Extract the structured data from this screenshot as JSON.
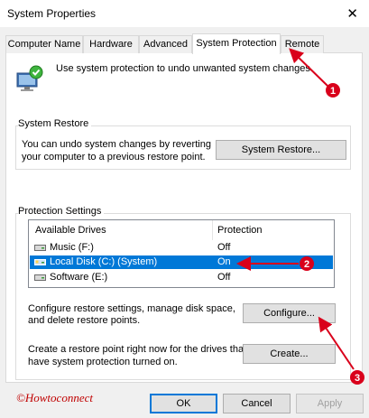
{
  "window": {
    "title": "System Properties",
    "close_glyph": "✕"
  },
  "tabs": [
    {
      "label": "Computer Name"
    },
    {
      "label": "Hardware"
    },
    {
      "label": "Advanced"
    },
    {
      "label": "System Protection",
      "active": true
    },
    {
      "label": "Remote"
    }
  ],
  "intro": {
    "text": "Use system protection to undo unwanted system changes."
  },
  "system_restore": {
    "group_label": "System Restore",
    "description_line1": "You can undo system changes by reverting",
    "description_line2": "your computer to a previous restore point.",
    "button_label": "System Restore..."
  },
  "protection_settings": {
    "group_label": "Protection Settings",
    "columns": {
      "drives": "Available Drives",
      "protection": "Protection"
    },
    "drives": [
      {
        "name": "Music (F:)",
        "protection": "Off",
        "icon": "drive-icon"
      },
      {
        "name": "Local Disk (C:) (System)",
        "protection": "On",
        "icon": "system-drive-icon",
        "selected": true
      },
      {
        "name": "Software (E:)",
        "protection": "Off",
        "icon": "drive-icon"
      }
    ],
    "configure_text_line1": "Configure restore settings, manage disk space,",
    "configure_text_line2": "and delete restore points.",
    "configure_button": "Configure...",
    "create_text_line1": "Create a restore point right now for the drives that",
    "create_text_line2": "have system protection turned on.",
    "create_button": "Create..."
  },
  "footer": {
    "ok": "OK",
    "cancel": "Cancel",
    "apply": "Apply"
  },
  "watermark": "©Howtoconnect",
  "annotations": [
    {
      "label": "1"
    },
    {
      "label": "2"
    },
    {
      "label": "3"
    }
  ],
  "colors": {
    "annotation": "#d9001b",
    "selection": "#0078d7",
    "watermark": "#c00000"
  }
}
